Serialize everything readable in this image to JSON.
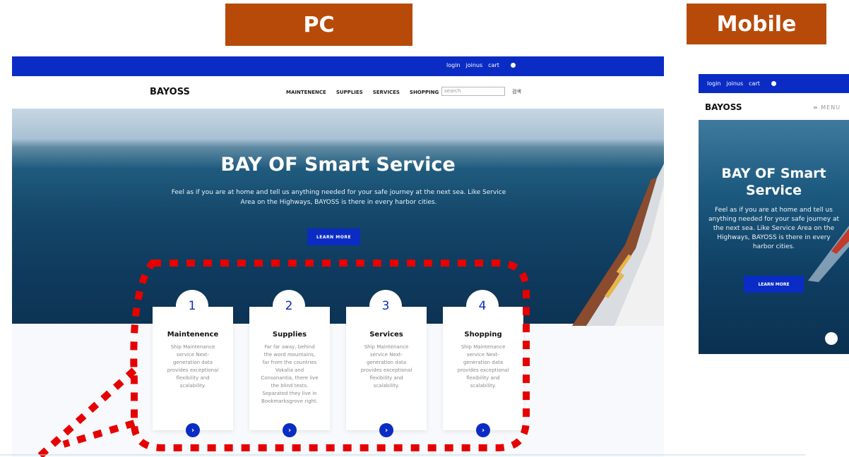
{
  "labels": {
    "pc": "PC",
    "mobile": "Mobile"
  },
  "pc": {
    "toplinks": [
      "login",
      "joinus",
      "cart"
    ],
    "logo": "BAYOSS",
    "menu": [
      "MAINTENENCE",
      "SUPPLIES",
      "SERVICES",
      "SHOPPING"
    ],
    "search_placeholder": "search",
    "search_button": "검색",
    "hero_title": "BAY OF Smart Service",
    "hero_text": "Feel as if you are at home and tell us anything needed for your safe journey at the next sea. Like Service Area on the Highways, BAYOSS is there in every harbor cities.",
    "learn_more": "LEARN MORE",
    "cards": [
      {
        "num": "1",
        "title": "Maintenence",
        "desc": "Ship Maintenance service Next-generation data provides exceptional flexibility and scalability."
      },
      {
        "num": "2",
        "title": "Supplies",
        "desc": "Far far away, behind the word mountains, far from the countries Vokalia and Consonantia, there live the blind texts. Separated they live in Bookmarksgrove right."
      },
      {
        "num": "3",
        "title": "Services",
        "desc": "Ship Maintenance service Next-generation data provides exceptional flexibility and scalability."
      },
      {
        "num": "4",
        "title": "Shopping",
        "desc": "Ship Maintenance service Next-generation data provides exceptional flexibility and scalability."
      }
    ],
    "arrow_glyph": "›"
  },
  "mobile": {
    "toplinks": [
      "login",
      "joinus",
      "cart"
    ],
    "logo": "BAYOSS",
    "menu": "≡ MENU",
    "hero_title": "BAY OF Smart Service",
    "hero_text": "Feel as if you are at home and tell us anything needed for your safe journey at the next sea. Like Service Area on the Highways, BAYOSS is there in every harbor cities.",
    "learn_more": "LEARN MORE"
  },
  "colors": {
    "label_bg": "#b84a09",
    "brand_blue": "#0b2cc4",
    "highlight_dots": "#e60000"
  },
  "icons": {
    "globe": "globe-icon",
    "chevron": "chevron-right-icon",
    "chat": "chat-icon"
  }
}
